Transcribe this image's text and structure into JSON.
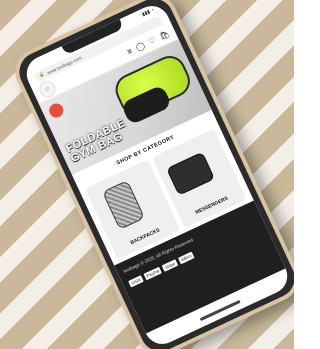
{
  "browser": {
    "url": "www.lootbags.com"
  },
  "site": {
    "hero_title_lines": [
      "FOLDABLE",
      "GYM BAG"
    ],
    "section_title": "SHOP BY CATEGORY",
    "categories": [
      {
        "label": "BACKPACKS"
      },
      {
        "label": "MESSENGERS"
      }
    ],
    "footer": {
      "copyright": "lootbags © 2020, All Rights Reserved",
      "payments": [
        "VISA",
        "PayPal",
        "stripe",
        "Affirm"
      ]
    }
  }
}
